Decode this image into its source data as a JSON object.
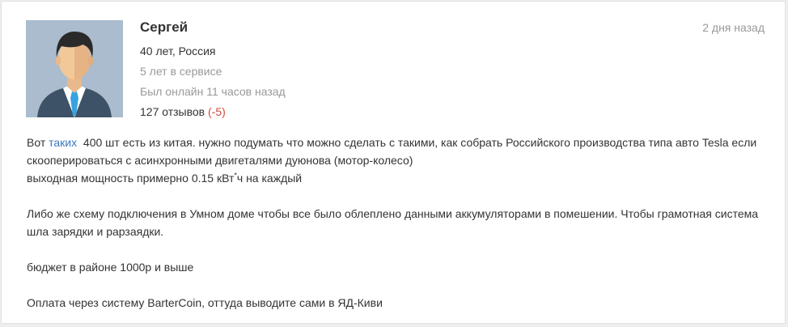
{
  "review": {
    "author": "Сергей",
    "age_country": "40 лет, Россия",
    "service": "5 лет в сервисе",
    "online": "Был онлайн 11 часов назад",
    "reviews_count": "127 отзывов",
    "reviews_delta": "(-5)",
    "date": "2 дня назад"
  },
  "message": {
    "p1_pre": "Вот ",
    "p1_link": "таких",
    "p1_post": "  400 шт есть из китая. нужно подумать что можно сделать с такими, как собрать Российского производства типа авто Tesla если скооперироваться с асинхронными двигеталями дуюнова (мотор-колесо)",
    "p2_pre": "выходная мощность примерно 0.15 кВт",
    "p2_sup": "*",
    "p2_post": "ч на каждый",
    "p3": "Либо же схему подключения в Умном доме чтобы все было облеплено данными аккумуляторами в помешении. Чтобы грамотная система шла зарядки и рарзаядки.",
    "p4": "бюджет в районе 1000р и выше",
    "p5": "Оплата через систему BarterCoin, оттуда выводите сами в ЯД-Киви"
  },
  "colors": {
    "link": "#3a7bbf",
    "negative": "#d34a3d",
    "muted": "#999999",
    "avatar_bg": "#aabccd"
  }
}
